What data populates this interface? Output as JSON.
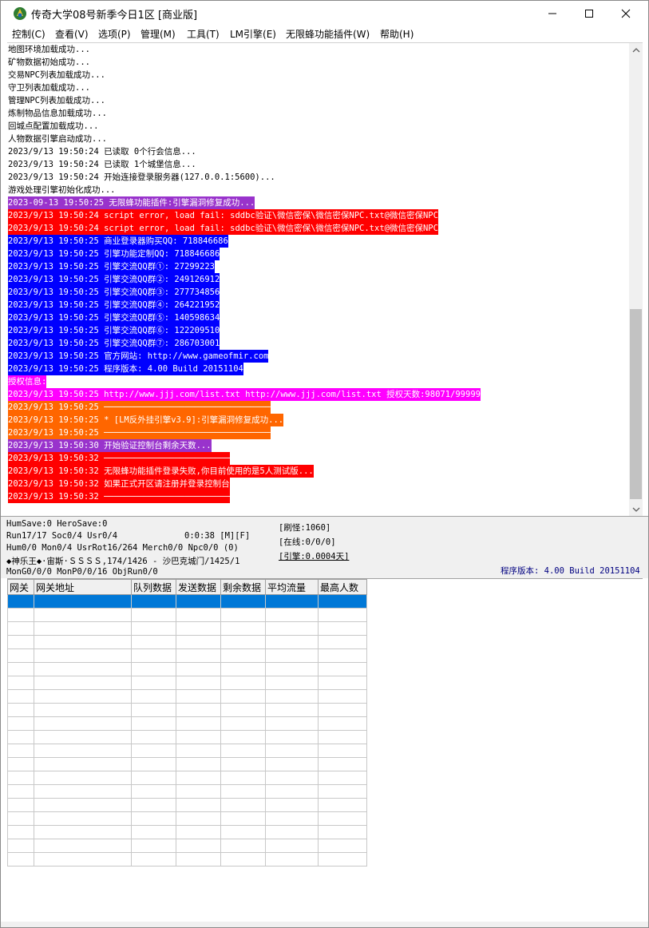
{
  "window": {
    "title": "传奇大学08号新季今日1区 [商业版]",
    "minimize_icon": "minimize-icon",
    "maximize_icon": "maximize-icon",
    "close_icon": "close-icon"
  },
  "menu": [
    "控制(C)",
    "查看(V)",
    "选项(P)",
    "管理(M)",
    "工具(T)",
    "LM引擎(E)",
    "无限蜂功能插件(W)",
    "帮助(H)"
  ],
  "colors": {
    "log_blue": "#0000ff",
    "log_red": "#ff0000",
    "log_purple": "#9933cc",
    "log_magenta": "#ff00ff",
    "log_orange": "#ff6600",
    "selection": "#0078d7",
    "status_blue": "#000080"
  },
  "log": [
    {
      "text": "地图环境加载成功...",
      "bg": ""
    },
    {
      "text": "矿物数据初始成功...",
      "bg": ""
    },
    {
      "text": "交易NPC列表加载成功...",
      "bg": ""
    },
    {
      "text": "守卫列表加载成功...",
      "bg": ""
    },
    {
      "text": "管理NPC列表加载成功...",
      "bg": ""
    },
    {
      "text": "炼制物品信息加载成功...",
      "bg": ""
    },
    {
      "text": "回城点配置加载成功...",
      "bg": ""
    },
    {
      "text": "人物数据引擎启动成功...",
      "bg": ""
    },
    {
      "text": "2023/9/13 19:50:24 已读取 0个行会信息...",
      "bg": ""
    },
    {
      "text": "2023/9/13 19:50:24 已读取 1个城堡信息...",
      "bg": ""
    },
    {
      "text": "2023/9/13 19:50:24 开始连接登录服务器(127.0.0.1:5600)...",
      "bg": ""
    },
    {
      "text": "游戏处理引擎初始化成功...",
      "bg": ""
    },
    {
      "text": "2023-09-13 19:50:25 无限蜂功能插件:引擎漏洞修复成功...",
      "bg": "#9933cc"
    },
    {
      "text": "2023/9/13 19:50:24 script error, load fail: sddbc验证\\微信密保\\微信密保NPC.txt@微信密保NPC",
      "bg": "#ff0000"
    },
    {
      "text": "2023/9/13 19:50:24 script error, load fail: sddbc验证\\微信密保\\微信密保NPC.txt@微信密保NPC",
      "bg": "#ff0000"
    },
    {
      "text": "2023/9/13 19:50:25 商业登录器购买QQ: 718846686",
      "bg": "#0000ff"
    },
    {
      "text": "2023/9/13 19:50:25 引擎功能定制QQ: 718846686",
      "bg": "#0000ff"
    },
    {
      "text": "2023/9/13 19:50:25 引擎交流QQ群①: 27299223",
      "bg": "#0000ff"
    },
    {
      "text": "2023/9/13 19:50:25 引擎交流QQ群②: 249126912",
      "bg": "#0000ff"
    },
    {
      "text": "2023/9/13 19:50:25 引擎交流QQ群③: 277734856",
      "bg": "#0000ff"
    },
    {
      "text": "2023/9/13 19:50:25 引擎交流QQ群④: 264221952",
      "bg": "#0000ff"
    },
    {
      "text": "2023/9/13 19:50:25 引擎交流QQ群⑤: 140598634",
      "bg": "#0000ff"
    },
    {
      "text": "2023/9/13 19:50:25 引擎交流QQ群⑥: 122209510",
      "bg": "#0000ff"
    },
    {
      "text": "2023/9/13 19:50:25 引擎交流QQ群⑦: 286703001",
      "bg": "#0000ff"
    },
    {
      "text": "2023/9/13 19:50:25 官方网站: http://www.gameofmir.com",
      "bg": "#0000ff"
    },
    {
      "text": "2023/9/13 19:50:25 程序版本: 4.00 Build 20151104",
      "bg": "#0000ff"
    },
    {
      "text": "授权信息:",
      "bg": "#ff00ff"
    },
    {
      "text": "2023/9/13 19:50:25 http://www.jjj.com/list.txt http://www.jjj.com/list.txt 授权天数:98071/99999",
      "bg": "#ff00ff"
    },
    {
      "text": "2023/9/13 19:50:25 ─────────────────────────────────",
      "bg": "#ff6600"
    },
    {
      "text": "2023/9/13 19:50:25 * [LM反外挂引擎v3.9]:引擎漏洞修复成功...",
      "bg": "#ff6600"
    },
    {
      "text": "2023/9/13 19:50:25 ─────────────────────────────────",
      "bg": "#ff6600"
    },
    {
      "text": "2023/9/13 19:50:30 开始验证控制台剩余天数...",
      "bg": "#9933cc"
    },
    {
      "text": "2023/9/13 19:50:32 ─────────────────────────",
      "bg": "#ff0000"
    },
    {
      "text": "2023/9/13 19:50:32 无限蜂功能插件登录失败,你目前使用的是5人测试版...",
      "bg": "#ff0000"
    },
    {
      "text": "2023/9/13 19:50:32 如果正式开区请注册并登录控制台",
      "bg": "#ff0000"
    },
    {
      "text": "2023/9/13 19:50:32 ─────────────────────────",
      "bg": "#ff0000"
    }
  ],
  "status": {
    "line1": "HumSave:0 HeroSave:0",
    "line2": "Run17/17 Soc0/4 Usr0/4",
    "time": "0:0:38 [M][F]",
    "line3": "Hum0/0 Mon0/4 UsrRot16/264 Merch0/0 Npc0/0 (0)",
    "line4": "◆神乐王◆·宙斯·ＳＳＳＳ,174/1426 - 沙巴克城门/1425/1",
    "line5": "MonG0/0/0 MonP0/0/16 ObjRun0/0",
    "refresh": "[刷怪:1060]",
    "online": "[在线:0/0/0]",
    "engine": "[引擎:0.0004天]",
    "version": "程序版本: 4.00 Build 20151104"
  },
  "grid": {
    "headers": [
      "网关",
      "网关地址",
      "队列数据",
      "发送数据",
      "剩余数据",
      "平均流量",
      "最高人数"
    ]
  }
}
